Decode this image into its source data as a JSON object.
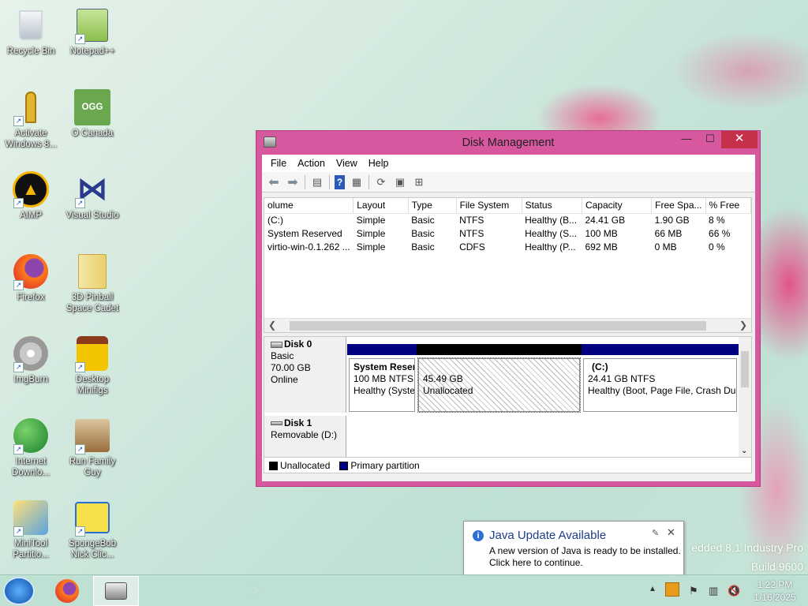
{
  "desktop": {
    "icons": [
      {
        "label": "Recycle Bin"
      },
      {
        "label": "Notepad++"
      },
      {
        "label": "Activate Windows 8..."
      },
      {
        "label": "O Canada"
      },
      {
        "label": "AIMP"
      },
      {
        "label": "Visual Studio"
      },
      {
        "label": "Firefox"
      },
      {
        "label": "3D Pinball Space Cadet"
      },
      {
        "label": "ImgBurn"
      },
      {
        "label": "Desktop Minifigs"
      },
      {
        "label": "Internet Downlo..."
      },
      {
        "label": "Run Family Guy"
      },
      {
        "label": "MiniTool Partitio..."
      },
      {
        "label": "SpongeBob Nick Clic..."
      }
    ],
    "ogg_text": "OGG",
    "watermark_line1": "edded 8.1 Industry Pro",
    "watermark_line2": "Build 9600"
  },
  "window": {
    "title": "Disk Management",
    "menu": [
      "File",
      "Action",
      "View",
      "Help"
    ],
    "columns": [
      "olume",
      "Layout",
      "Type",
      "File System",
      "Status",
      "Capacity",
      "Free Spa...",
      "% Free"
    ],
    "rows": [
      [
        "(C:)",
        "Simple",
        "Basic",
        "NTFS",
        "Healthy (B...",
        "24.41 GB",
        "1.90 GB",
        "8 %"
      ],
      [
        "System Reserved",
        "Simple",
        "Basic",
        "NTFS",
        "Healthy (S...",
        "100 MB",
        "66 MB",
        "66 %"
      ],
      [
        "virtio-win-0.1.262 ...",
        "Simple",
        "Basic",
        "CDFS",
        "Healthy (P...",
        "692 MB",
        "0 MB",
        "0 %"
      ]
    ],
    "disk0": {
      "name": "Disk 0",
      "type": "Basic",
      "size": "70.00 GB",
      "state": "Online",
      "partitions": [
        {
          "name": "System Reser",
          "size": "100 MB NTFS",
          "status": "Healthy (Syste"
        },
        {
          "name": "",
          "size": "45.49 GB",
          "status": "Unallocated"
        },
        {
          "name": "(C:)",
          "size": "24.41 GB NTFS",
          "status": "Healthy (Boot, Page File, Crash Dur"
        }
      ]
    },
    "disk1": {
      "name": "Disk 1",
      "type": "Removable (D:)"
    },
    "legend": {
      "unallocated": "Unallocated",
      "primary": "Primary partition"
    },
    "colors": {
      "primary": "#000080",
      "unallocated": "#000000",
      "frame": "#d7589f"
    }
  },
  "balloon": {
    "title": "Java Update Available",
    "line1": "A new version of Java is ready to be installed.",
    "line2": "Click here to continue."
  },
  "taskbar": {
    "time": "1:22 PM",
    "date": "1/16/2025"
  }
}
